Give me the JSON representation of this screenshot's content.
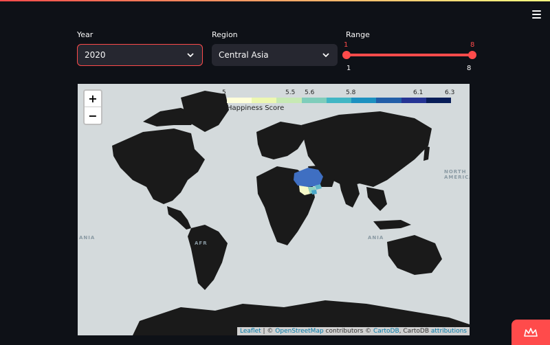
{
  "header": {
    "menu_icon": "hamburger-menu-icon"
  },
  "filters": {
    "year": {
      "label": "Year",
      "value": "2020"
    },
    "region": {
      "label": "Region",
      "value": "Central Asia"
    },
    "range": {
      "label": "Range",
      "low": "1",
      "high": "8",
      "min_label": "1",
      "max_label": "8"
    }
  },
  "map": {
    "zoom_in": "+",
    "zoom_out": "−",
    "legend": {
      "caption": "Happiness Score",
      "ticks": [
        "5",
        "5.5",
        "5.6",
        "5.8",
        "6.1",
        "6.3"
      ],
      "colors": [
        "#ffffd9",
        "#edf8b1",
        "#c7e9b4",
        "#7fcdbb",
        "#41b6c4",
        "#1d91c0",
        "#225ea8",
        "#253494",
        "#081d58"
      ]
    },
    "labels": {
      "north_america": [
        "NORTH",
        "AMERICA"
      ],
      "west_edge": "ANIA",
      "africa_partial": "AFR",
      "east_edge": "ANIA"
    },
    "attribution": {
      "leaflet": "Leaflet",
      "sep1": " | © ",
      "osm": "OpenStreetMap",
      "contrib": " contributors © ",
      "carto": "CartoDB",
      "carto_sep": ", CartoDB ",
      "attr": "attributions"
    },
    "highlight_colors": {
      "kazakhstan": "#3f6fc2",
      "uzbekistan": "#f6f9c8",
      "turkmenistan": "#8fd3c0",
      "kyrgyzstan": "#5fb7c9",
      "tajikistan": "#4aa7c8"
    }
  },
  "badge": {
    "icon": "crown-icon"
  }
}
